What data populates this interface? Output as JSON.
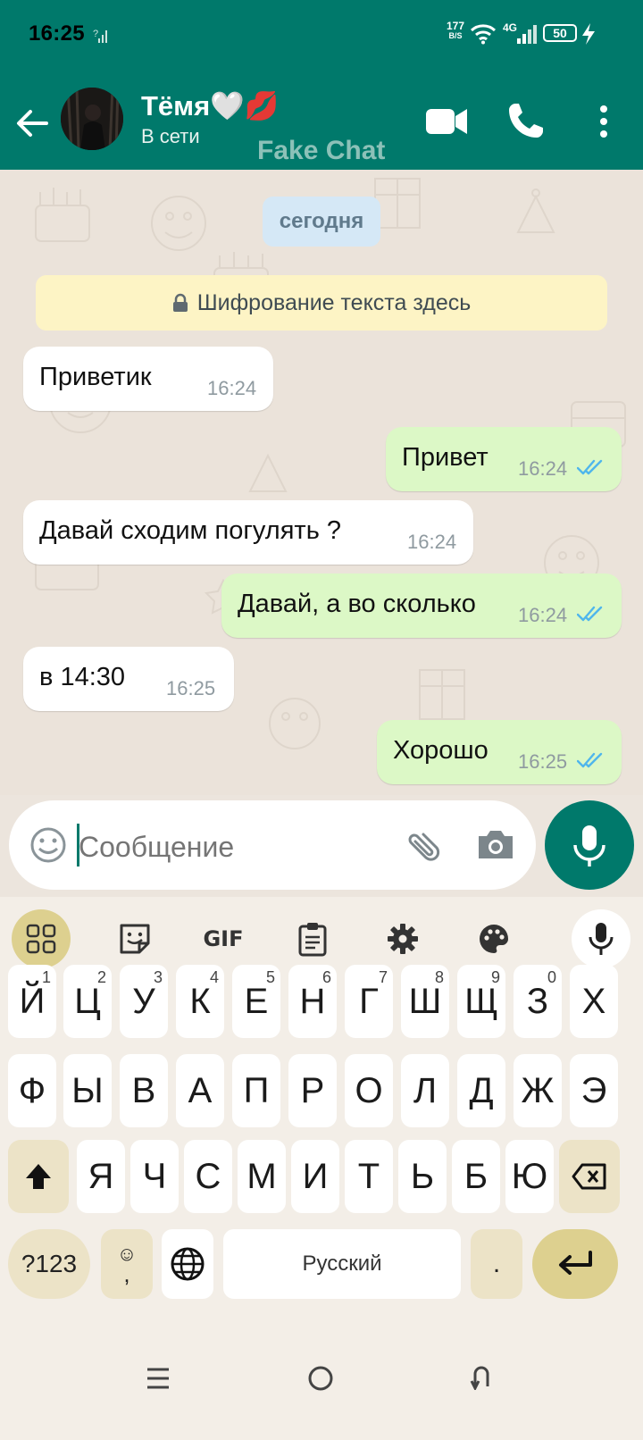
{
  "status_bar": {
    "time": "16:25",
    "net_speed_value": "177",
    "net_speed_unit": "B/S",
    "network_type": "4G",
    "battery": "50"
  },
  "header": {
    "contact_name": "Тёмя🤍💋",
    "status": "В сети",
    "watermark": "Fake Chat"
  },
  "chat": {
    "date_chip": "сегодня",
    "encryption_notice": "Шифрование текста здесь",
    "messages": [
      {
        "dir": "in",
        "text": "Приветик",
        "time": "16:24"
      },
      {
        "dir": "out",
        "text": "Привет",
        "time": "16:24",
        "read": true
      },
      {
        "dir": "in",
        "text": "Давай сходим погулять ?",
        "time": "16:24"
      },
      {
        "dir": "out",
        "text": "Давай, а во сколько",
        "time": "16:24",
        "read": true
      },
      {
        "dir": "in",
        "text": "в 14:30",
        "time": "16:25"
      },
      {
        "dir": "out",
        "text": "Хорошо",
        "time": "16:25",
        "read": true
      }
    ]
  },
  "composer": {
    "placeholder": "Сообщение"
  },
  "keyboard": {
    "toolbar_gif": "GIF",
    "row1": [
      "Й",
      "Ц",
      "У",
      "К",
      "Е",
      "Н",
      "Г",
      "Ш",
      "Щ",
      "З",
      "Х"
    ],
    "row1_hints": [
      "1",
      "2",
      "3",
      "4",
      "5",
      "6",
      "7",
      "8",
      "9",
      "0",
      ""
    ],
    "row2": [
      "Ф",
      "Ы",
      "В",
      "А",
      "П",
      "Р",
      "О",
      "Л",
      "Д",
      "Ж",
      "Э"
    ],
    "row3": [
      "Я",
      "Ч",
      "С",
      "М",
      "И",
      "Т",
      "Ь",
      "Б",
      "Ю"
    ],
    "symbols_key": "?123",
    "emoji_comma_top": "☺",
    "emoji_comma_bottom": ",",
    "space_label": "Русский",
    "period": "."
  },
  "colors": {
    "header": "#00796b",
    "chat_bg": "#ebe3da",
    "incoming_bubble": "#ffffff",
    "outgoing_bubble": "#dcf8c6",
    "read_ticks": "#4fb6ec",
    "keyboard_bg": "#f3eee7",
    "keyboard_accent": "#ddd08f"
  }
}
